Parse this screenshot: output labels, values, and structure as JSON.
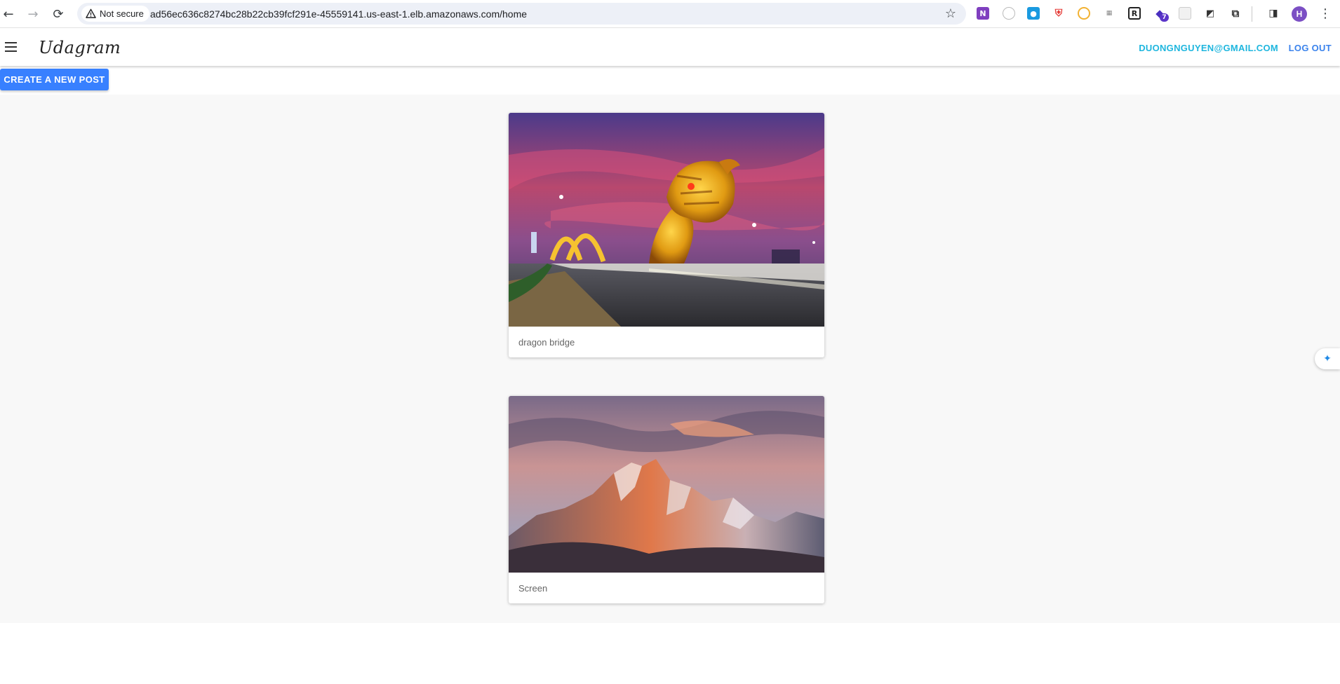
{
  "browser": {
    "security_label": "Not secure",
    "url": "ad56ec636c8274bc28b22cb39fcf291e-45559141.us-east-1.elb.amazonaws.com/home",
    "extension_badge": "7",
    "profile_initial": "H"
  },
  "app": {
    "brand": "Udagram",
    "user_email": "DUONGNGUYEN@GMAIL.COM",
    "logout_label": "LOG OUT",
    "create_post_label": "CREATE A NEW POST"
  },
  "feed": {
    "posts": [
      {
        "caption": "dragon bridge"
      },
      {
        "caption": "Screen"
      }
    ]
  },
  "colors": {
    "accent": "#3880ff",
    "email": "#1eb6de",
    "logout": "#3b83ec"
  }
}
